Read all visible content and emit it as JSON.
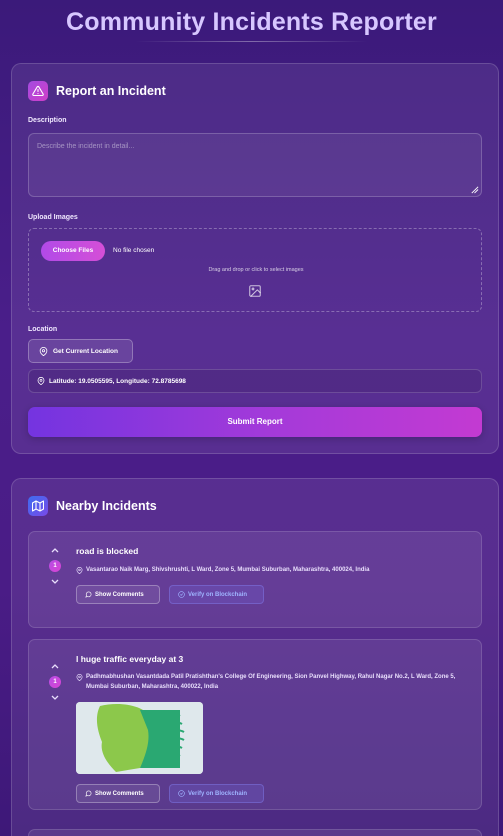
{
  "app": {
    "title": "Community Incidents Reporter"
  },
  "report": {
    "heading": "Report an Incident",
    "description_label": "Description",
    "description_placeholder": "Describe the incident in detail...",
    "upload_label": "Upload Images",
    "choose_files": "Choose Files",
    "no_file": "No file chosen",
    "drag_text": "Drag and drop or click to select images",
    "location_label": "Location",
    "get_location": "Get Current Location",
    "coords": "Latitude: 19.0505595, Longitude: 72.8785698",
    "submit": "Submit Report"
  },
  "nearby": {
    "heading": "Nearby Incidents",
    "incidents": [
      {
        "title": "road is blocked",
        "votes": "1",
        "address": "Vasantarao Naik Marg, Shivshrushti, L Ward, Zone 5, Mumbai Suburban, Maharashtra, 400024, India",
        "comments_label": "Show Comments",
        "verify_label": "Verify on Blockchain"
      },
      {
        "title": "l huge traffic everyday at 3",
        "votes": "1",
        "address": "Padhmabhushan Vasantdada Patil Pratishthan's College Of Engineering, Sion Panvel Highway, Rahul Nagar No.2, L Ward, Zone 5, Mumbai Suburban, Maharashtra, 400022, India",
        "comments_label": "Show Comments",
        "verify_label": "Verify on Blockchain"
      }
    ]
  },
  "icons": {
    "report": "alert-triangle-icon",
    "nearby": "map-icon",
    "location": "map-pin-icon",
    "image": "image-icon",
    "upvote": "chevron-up-icon",
    "downvote": "chevron-down-icon",
    "comments": "message-circle-icon",
    "verify": "check-circle-icon"
  },
  "colors": {
    "accent": "#c33ad2",
    "accent_start": "#7434e0",
    "verify_text": "#9fb4ff"
  }
}
